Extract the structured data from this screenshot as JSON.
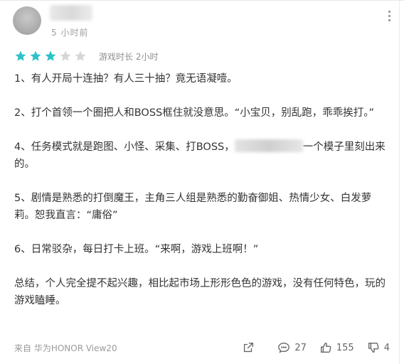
{
  "review": {
    "time": "5 小时前",
    "rating": 3,
    "rating_max": 5,
    "star_filled_color": "#2cc1c9",
    "star_empty_color": "#d6d6d6",
    "playtime": "游戏时长 2小时",
    "paragraphs": {
      "p1": "1、有人开局十连抽？有人三十抽？竟无语凝噎。",
      "p2": "2、打个首领一个圈把人和BOSS框住就没意思。“小宝贝，别乱跑，乖乖挨打。”",
      "p3_before": "4、任务模式就是跑图、小怪、采集、打BOSS，",
      "p3_after": "一个模子里刻出来的。",
      "p4": "5、剧情是熟悉的打倒魔王，主角三人组是熟悉的勤奋御姐、热情少女、白发萝莉。恕我直言：“庸俗”",
      "p5": "6、日常驳杂，每日打卡上班。“来啊，游戏上班啊！”",
      "p6": "总结，个人完全提不起兴趣，相比起市场上形形色色的游戏，没有任何特色，玩的游戏瞌睡。"
    },
    "device": "来自 华为HONOR View20",
    "actions": {
      "share_icon": "share-icon",
      "comments": "27",
      "likes": "155",
      "dislikes": "4"
    }
  }
}
